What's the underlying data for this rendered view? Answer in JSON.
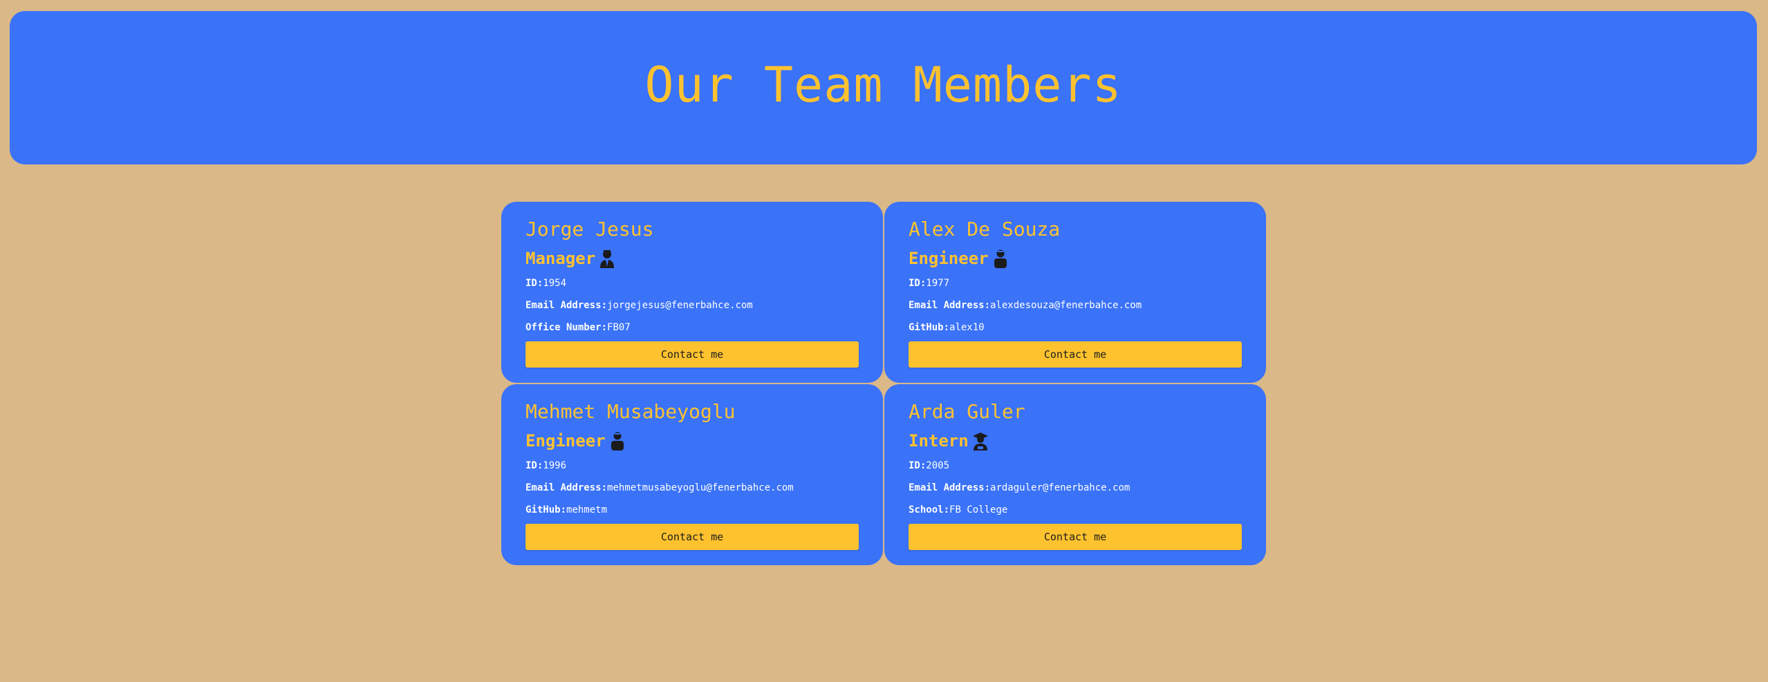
{
  "header": {
    "title": "Our Team Members"
  },
  "colors": {
    "background": "#dbb887",
    "panel": "#3a72f8",
    "accent": "#fec22f",
    "text": "#ffffff"
  },
  "cards": [
    {
      "name": "Jorge Jesus",
      "role": "Manager",
      "icon": "manager-icon",
      "id_label": "ID:",
      "id": "1954",
      "email_label": "Email Address:",
      "email": "jorgejesus@fenerbahce.com",
      "extra_label": "Office Number:",
      "extra": "FB07",
      "button": "Contact me"
    },
    {
      "name": "Alex De Souza",
      "role": "Engineer",
      "icon": "engineer-icon",
      "id_label": "ID:",
      "id": "1977",
      "email_label": "Email Address:",
      "email": "alexdesouza@fenerbahce.com",
      "extra_label": "GitHub:",
      "extra": "alex10",
      "button": "Contact me"
    },
    {
      "name": "Mehmet Musabeyoglu",
      "role": "Engineer",
      "icon": "engineer-icon",
      "id_label": "ID:",
      "id": "1996",
      "email_label": "Email Address:",
      "email": "mehmetmusabeyoglu@fenerbahce.com",
      "extra_label": "GitHub:",
      "extra": "mehmetm",
      "button": "Contact me"
    },
    {
      "name": "Arda Guler",
      "role": "Intern",
      "icon": "intern-icon",
      "id_label": "ID:",
      "id": "2005",
      "email_label": "Email Address:",
      "email": "ardaguler@fenerbahce.com",
      "extra_label": "School:",
      "extra": "FB College",
      "button": "Contact me"
    }
  ]
}
